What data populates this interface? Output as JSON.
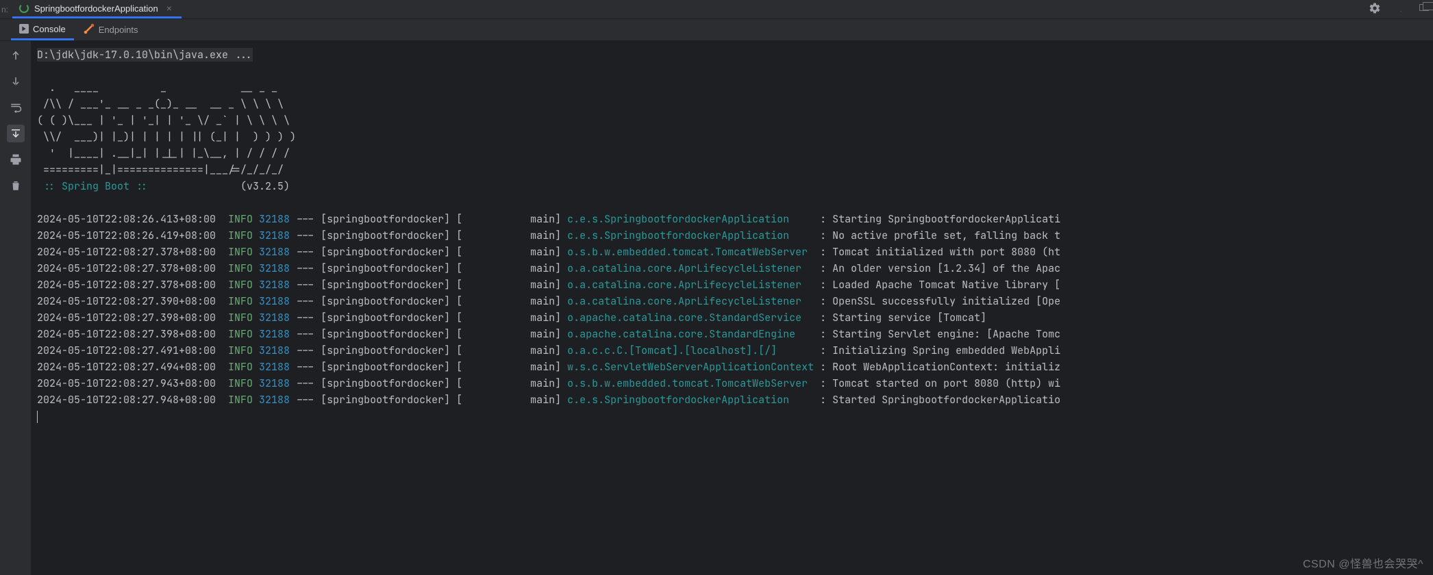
{
  "prefix": "n:",
  "runTab": {
    "title": "SpringbootfordockerApplication"
  },
  "subTabs": {
    "console": "Console",
    "endpoints": "Endpoints"
  },
  "cmdLine": "D:\\jdk\\jdk-17.0.10\\bin\\java.exe ...",
  "banner": [
    "  .   ____          _            __ _ _",
    " /\\\\ / ___'_ __ _ _(_)_ __  __ _ \\ \\ \\ \\",
    "( ( )\\___ | '_ | '_| | '_ \\/ _` | \\ \\ \\ \\",
    " \\\\/  ___)| |_)| | | | | || (_| |  ) ) ) )",
    "  '  |____| .__|_| |_|_| |_\\__, | / / / /",
    " =========|_|==============|___/=/_/_/_/"
  ],
  "springLine": {
    "label": " :: Spring Boot :: ",
    "version": "(v3.2.5)"
  },
  "logs": [
    {
      "ts": "2024-05-10T22:08:26.413+08:00",
      "level": "INFO",
      "pid": "32188",
      "sep": "---",
      "ctx": "[springbootfordocker] [           main]",
      "logger": "c.e.s.SpringbootfordockerApplication    ",
      "msg": ": Starting SpringbootfordockerApplicati"
    },
    {
      "ts": "2024-05-10T22:08:26.419+08:00",
      "level": "INFO",
      "pid": "32188",
      "sep": "---",
      "ctx": "[springbootfordocker] [           main]",
      "logger": "c.e.s.SpringbootfordockerApplication    ",
      "msg": ": No active profile set, falling back t"
    },
    {
      "ts": "2024-05-10T22:08:27.378+08:00",
      "level": "INFO",
      "pid": "32188",
      "sep": "---",
      "ctx": "[springbootfordocker] [           main]",
      "logger": "o.s.b.w.embedded.tomcat.TomcatWebServer ",
      "msg": ": Tomcat initialized with port 8080 (ht"
    },
    {
      "ts": "2024-05-10T22:08:27.378+08:00",
      "level": "INFO",
      "pid": "32188",
      "sep": "---",
      "ctx": "[springbootfordocker] [           main]",
      "logger": "o.a.catalina.core.AprLifecycleListener  ",
      "msg": ": An older version [1.2.34] of the Apac"
    },
    {
      "ts": "2024-05-10T22:08:27.378+08:00",
      "level": "INFO",
      "pid": "32188",
      "sep": "---",
      "ctx": "[springbootfordocker] [           main]",
      "logger": "o.a.catalina.core.AprLifecycleListener  ",
      "msg": ": Loaded Apache Tomcat Native library ["
    },
    {
      "ts": "2024-05-10T22:08:27.390+08:00",
      "level": "INFO",
      "pid": "32188",
      "sep": "---",
      "ctx": "[springbootfordocker] [           main]",
      "logger": "o.a.catalina.core.AprLifecycleListener  ",
      "msg": ": OpenSSL successfully initialized [Ope"
    },
    {
      "ts": "2024-05-10T22:08:27.398+08:00",
      "level": "INFO",
      "pid": "32188",
      "sep": "---",
      "ctx": "[springbootfordocker] [           main]",
      "logger": "o.apache.catalina.core.StandardService  ",
      "msg": ": Starting service [Tomcat]"
    },
    {
      "ts": "2024-05-10T22:08:27.398+08:00",
      "level": "INFO",
      "pid": "32188",
      "sep": "---",
      "ctx": "[springbootfordocker] [           main]",
      "logger": "o.apache.catalina.core.StandardEngine   ",
      "msg": ": Starting Servlet engine: [Apache Tomc"
    },
    {
      "ts": "2024-05-10T22:08:27.491+08:00",
      "level": "INFO",
      "pid": "32188",
      "sep": "---",
      "ctx": "[springbootfordocker] [           main]",
      "logger": "o.a.c.c.C.[Tomcat].[localhost].[/]      ",
      "msg": ": Initializing Spring embedded WebAppli"
    },
    {
      "ts": "2024-05-10T22:08:27.494+08:00",
      "level": "INFO",
      "pid": "32188",
      "sep": "---",
      "ctx": "[springbootfordocker] [           main]",
      "logger": "w.s.c.ServletWebServerApplicationContext",
      "msg": ": Root WebApplicationContext: initializ"
    },
    {
      "ts": "2024-05-10T22:08:27.943+08:00",
      "level": "INFO",
      "pid": "32188",
      "sep": "---",
      "ctx": "[springbootfordocker] [           main]",
      "logger": "o.s.b.w.embedded.tomcat.TomcatWebServer ",
      "msg": ": Tomcat started on port 8080 (http) wi"
    },
    {
      "ts": "2024-05-10T22:08:27.948+08:00",
      "level": "INFO",
      "pid": "32188",
      "sep": "---",
      "ctx": "[springbootfordocker] [           main]",
      "logger": "c.e.s.SpringbootfordockerApplication    ",
      "msg": ": Started SpringbootfordockerApplicatio"
    }
  ],
  "watermark": "CSDN @怪兽也会哭哭^"
}
